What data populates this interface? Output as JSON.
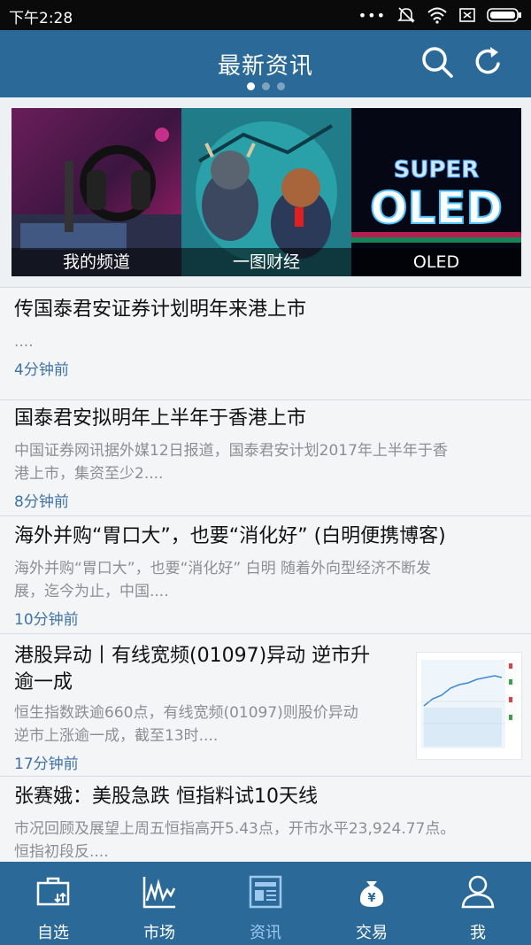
{
  "status_bar": {
    "time": "下午2:28"
  },
  "header": {
    "title": "最新资讯",
    "page_indicator": {
      "count": 3,
      "active": 1
    }
  },
  "banner": {
    "cards": [
      {
        "caption": "我的频道"
      },
      {
        "caption": "一图财经"
      },
      {
        "caption": "OLED",
        "art_text_line1": "SUPER",
        "art_text_line2": "OLED"
      }
    ]
  },
  "news": [
    {
      "title_lines": [
        "传国泰君安证券计划明年来港上市"
      ],
      "summary_lines": [
        "...."
      ],
      "time": "4分钟前"
    },
    {
      "title_lines": [
        "国泰君安拟明年上半年于香港上市"
      ],
      "summary_lines": [
        "中国证券网讯据外媒12日报道，国泰君安计划2017年上半年于香",
        "港上市，集资至少2...."
      ],
      "time": "8分钟前"
    },
    {
      "title_lines": [
        "海外并购“胃口大”，也要“消化好” (白明便携博客)"
      ],
      "summary_lines": [
        "海外并购“胃口大”，也要“消化好” 白明 随着外向型经济不断发",
        "展，迄今为止，中国...."
      ],
      "time": "10分钟前"
    },
    {
      "title_lines": [
        "港股异动丨有线宽频(01097)异动 逆市升",
        "逾一成"
      ],
      "summary_lines": [
        "恒生指数跌逾660点，有线宽频(01097)则股价异动",
        "逆市上涨逾一成，截至13时...."
      ],
      "time": "17分钟前"
    },
    {
      "title_lines": [
        "张赛娥：美股急跌 恒指料试10天线"
      ],
      "summary_lines": [
        "市况回顾及展望上周五恒指高开5.43点，开市水平23,924.77点。",
        "恒指初段反...."
      ],
      "time": ""
    }
  ],
  "tabs": [
    {
      "label": "自选",
      "icon": "briefcase-icon"
    },
    {
      "label": "市场",
      "icon": "market-chart-icon"
    },
    {
      "label": "资讯",
      "icon": "news-icon",
      "active": true
    },
    {
      "label": "交易",
      "icon": "money-bag-icon"
    },
    {
      "label": "我",
      "icon": "user-icon"
    }
  ],
  "colors": {
    "header_bg": "#2b6a98",
    "tab_bg": "#2b6a98",
    "time_text": "#3f73a8",
    "active_tab": "#9ec8ee"
  }
}
